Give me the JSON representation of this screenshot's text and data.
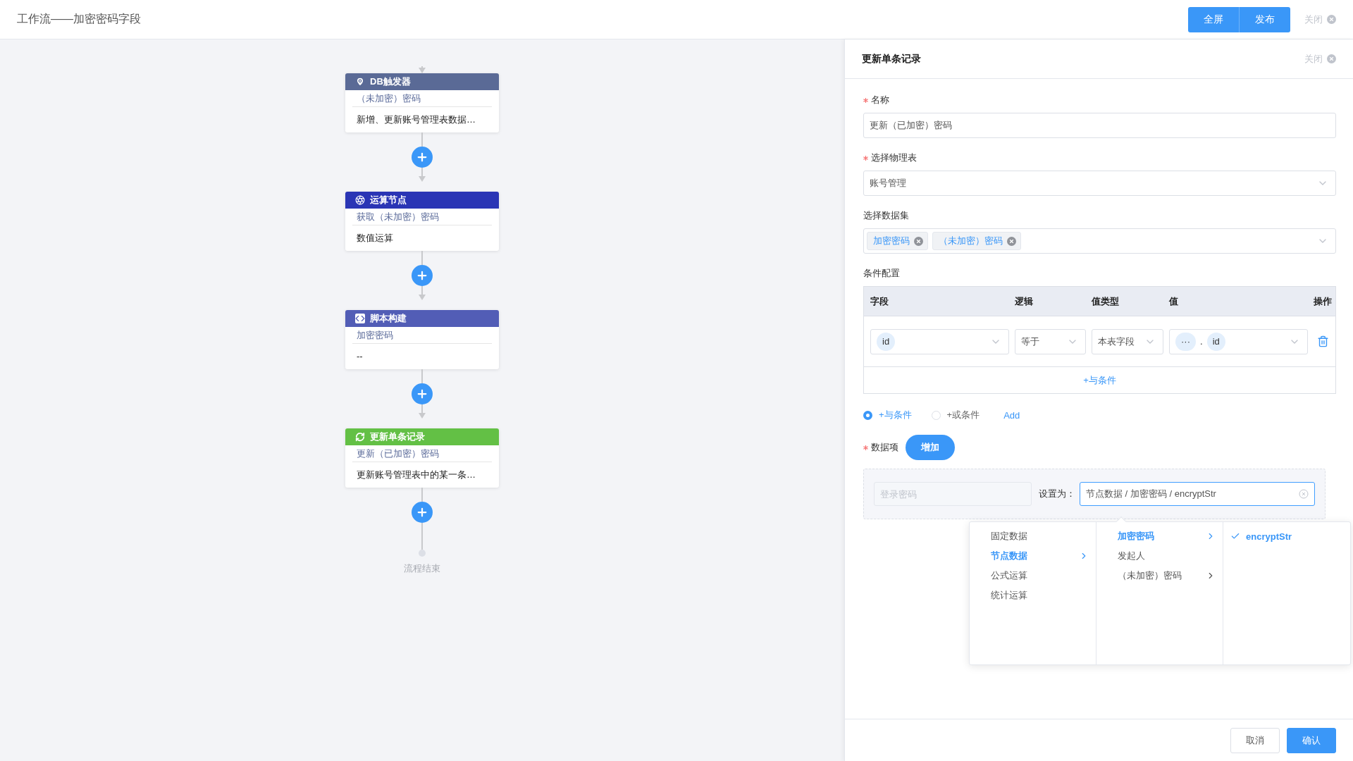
{
  "topbar": {
    "title": "工作流——加密密码字段",
    "buttons": [
      "全屏",
      "发布"
    ],
    "close": "关闭"
  },
  "flow": {
    "nodes": [
      {
        "kind": "trigger",
        "title": "DB触发器",
        "color": "#5a6a96",
        "subtitle": "（未加密）密码",
        "description": "新增、更新账号管理表数据…"
      },
      {
        "kind": "compute",
        "title": "运算节点",
        "color": "#2a35b5",
        "subtitle": "获取（未加密）密码",
        "description": "数值运算"
      },
      {
        "kind": "script",
        "title": "脚本构建",
        "color": "#525db6",
        "subtitle": "加密密码",
        "description": "--"
      },
      {
        "kind": "update",
        "title": "更新单条记录",
        "color": "#63c045",
        "subtitle": "更新（已加密）密码",
        "description": "更新账号管理表中的某一条…"
      }
    ],
    "end_label": "流程结束"
  },
  "panel": {
    "title": "更新单条记录",
    "close": "关闭",
    "fields": [
      {
        "kind": "text",
        "label": "名称",
        "required": true,
        "value": "更新（已加密）密码"
      },
      {
        "kind": "select",
        "label": "选择物理表",
        "required": true,
        "value": "账号管理"
      },
      {
        "kind": "tags",
        "label": "选择数据集",
        "required": false,
        "tags": [
          "加密密码",
          "（未加密）密码"
        ]
      }
    ],
    "conditions": {
      "label": "条件配置",
      "columns": [
        "字段",
        "逻辑",
        "值类型",
        "值",
        "操作"
      ],
      "rows": [
        {
          "field": "id",
          "logic": "等于",
          "value_type": "本表字段",
          "value_prefix": "···",
          "separator": ".",
          "value": "id"
        }
      ],
      "add_label": "+与条件"
    },
    "logic_options": [
      {
        "label": "+与条件",
        "selected": true
      },
      {
        "label": "+或条件",
        "selected": false
      }
    ],
    "add_link": "Add",
    "data_items": {
      "label": "数据项",
      "required": true,
      "add_button": "增加",
      "items": [
        {
          "field_placeholder": "登录密码",
          "set_label": "设置为：",
          "value": "节点数据 / 加密密码 / encryptStr"
        }
      ]
    },
    "cascader": [
      [
        {
          "label": "固定数据",
          "selected": false,
          "has_children": false
        },
        {
          "label": "节点数据",
          "selected": true,
          "has_children": true
        },
        {
          "label": "公式运算",
          "selected": false,
          "has_children": false
        },
        {
          "label": "统计运算",
          "selected": false,
          "has_children": false
        }
      ],
      [
        {
          "label": "加密密码",
          "selected": true,
          "has_children": true
        },
        {
          "label": "发起人",
          "selected": false,
          "has_children": false
        },
        {
          "label": "（未加密）密码",
          "selected": false,
          "has_children": true
        }
      ],
      [
        {
          "label": "encryptStr",
          "selected": true,
          "has_children": false
        }
      ]
    ],
    "footer": [
      {
        "kind": "default",
        "label": "取消"
      },
      {
        "kind": "primary",
        "label": "确认"
      }
    ]
  }
}
